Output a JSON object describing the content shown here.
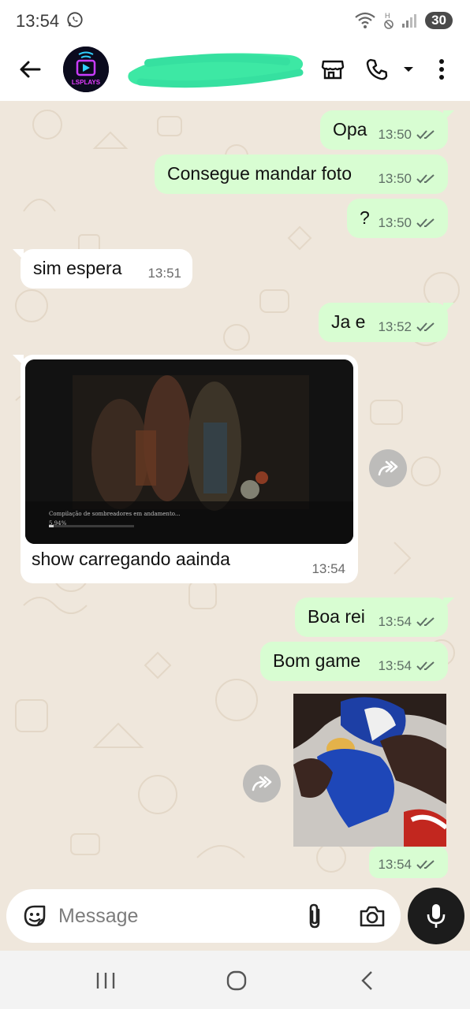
{
  "status_bar": {
    "time": "13:54",
    "battery": "30"
  },
  "app_bar": {
    "contact_name": ""
  },
  "messages": [
    {
      "direction": "out",
      "text": "Opa",
      "time": "13:50"
    },
    {
      "direction": "out",
      "text": "Consegue mandar foto",
      "time": "13:50"
    },
    {
      "direction": "out",
      "text": "?",
      "time": "13:50"
    },
    {
      "direction": "in",
      "text": "sim espera",
      "time": "13:51"
    },
    {
      "direction": "out",
      "text": "Ja e",
      "time": "13:52"
    },
    {
      "direction": "in",
      "type": "video",
      "caption": "show carregando aainda",
      "time": "13:54",
      "overlay_text": "Compilação de sombreadores em andamento...",
      "overlay_percent": "5,94%",
      "progress": 0.06
    },
    {
      "direction": "out",
      "text": "Boa rei",
      "time": "13:54"
    },
    {
      "direction": "out",
      "text": "Bom game",
      "time": "13:54"
    },
    {
      "direction": "out",
      "type": "photo",
      "time": "13:54"
    }
  ],
  "composer": {
    "placeholder": "Message"
  },
  "colors": {
    "outgoing_bubble": "#d8fdd2",
    "incoming_bubble": "#ffffff",
    "chat_background": "#efe7dc",
    "read_ticks": "#5f6f66"
  }
}
